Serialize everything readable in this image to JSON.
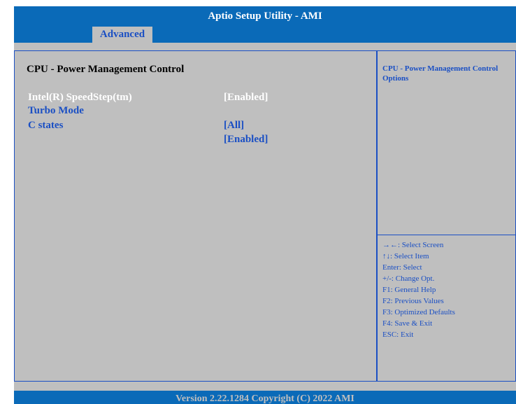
{
  "header": {
    "title": "Aptio Setup Utility - AMI"
  },
  "tabs": [
    {
      "label": "Advanced"
    }
  ],
  "main": {
    "section_title": "CPU - Power Management Control",
    "items": [
      {
        "label": "Intel(R) SpeedStep(tm)"
      },
      {
        "label": "Turbo Mode"
      },
      {
        "label": "C states"
      }
    ],
    "values": [
      {
        "value": "[Enabled]"
      },
      {
        "value": "[All]"
      },
      {
        "value": "[Enabled]"
      }
    ]
  },
  "help": {
    "description": "CPU - Power Management Control Options",
    "keys": [
      "→←: Select Screen",
      "↑↓: Select Item",
      "Enter: Select",
      "+/-: Change Opt.",
      "F1: General Help",
      "F2: Previous Values",
      "F3: Optimized Defaults",
      "F4: Save & Exit",
      "ESC: Exit"
    ]
  },
  "footer": {
    "text": "Version 2.22.1284 Copyright (C) 2022 AMI"
  },
  "colors": {
    "bar_blue": "#0a6ab8",
    "panel_gray": "#bfbfbf",
    "text_blue": "#1a4fc4",
    "selected_white": "#ffffff"
  }
}
